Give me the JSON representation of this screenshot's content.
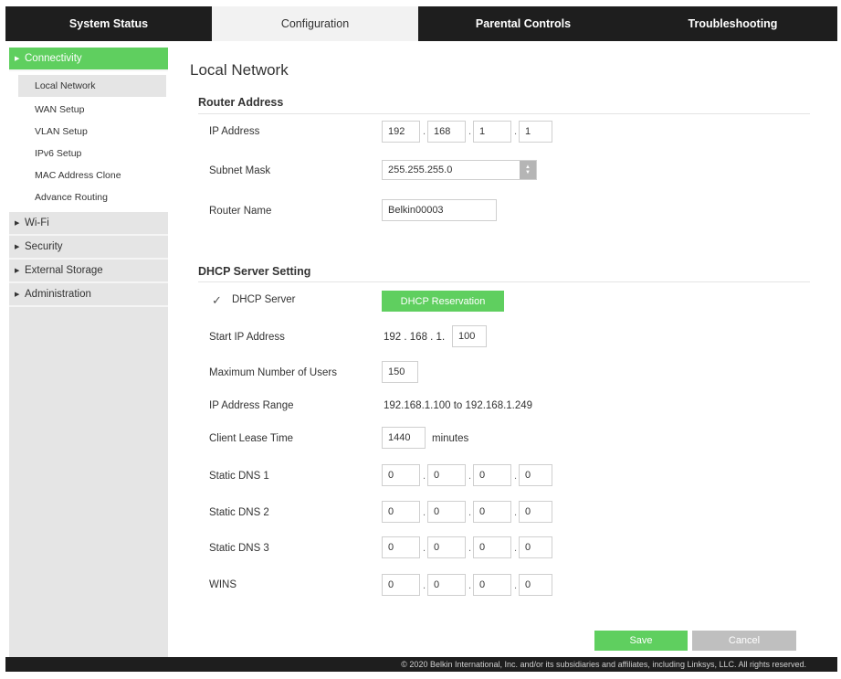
{
  "tabs": [
    {
      "label": "System Status"
    },
    {
      "label": "Configuration"
    },
    {
      "label": "Parental Controls"
    },
    {
      "label": "Troubleshooting"
    }
  ],
  "sidebar": {
    "connectivity": "Connectivity",
    "sub_items": [
      "Local Network",
      "WAN Setup",
      "VLAN Setup",
      "IPv6 Setup",
      "MAC Address Clone",
      "Advance Routing"
    ],
    "wifi": "Wi-Fi",
    "security": "Security",
    "external_storage": "External Storage",
    "administration": "Administration"
  },
  "page_title": "Local Network",
  "router_address": {
    "heading": "Router Address",
    "ip_label": "IP Address",
    "ip": [
      "192",
      "168",
      "1",
      "1"
    ],
    "subnet_label": "Subnet Mask",
    "subnet_value": "255.255.255.0",
    "router_name_label": "Router Name",
    "router_name_value": "Belkin00003"
  },
  "dhcp": {
    "heading": "DHCP Server Setting",
    "server_label": "DHCP Server",
    "check_mark": "✓",
    "reservation_button": "DHCP Reservation",
    "start_ip_label": "Start IP Address",
    "start_ip_prefix": "192 . 168 . 1.",
    "start_ip_last": "100",
    "max_users_label": "Maximum Number of Users",
    "max_users_value": "150",
    "range_label": "IP Address Range",
    "range_value": "192.168.1.100 to 192.168.1.249",
    "lease_label": "Client Lease Time",
    "lease_value": "1440",
    "lease_unit": "minutes",
    "dns1_label": "Static DNS 1",
    "dns1": [
      "0",
      "0",
      "0",
      "0"
    ],
    "dns2_label": "Static DNS 2",
    "dns2": [
      "0",
      "0",
      "0",
      "0"
    ],
    "dns3_label": "Static DNS 3",
    "dns3": [
      "0",
      "0",
      "0",
      "0"
    ],
    "wins_label": "WINS",
    "wins": [
      "0",
      "0",
      "0",
      "0"
    ]
  },
  "buttons": {
    "save": "Save",
    "cancel": "Cancel"
  },
  "footer": "© 2020 Belkin International, Inc. and/or its subsidiaries and affiliates, including Linksys, LLC. All rights reserved.",
  "colors": {
    "accent_green": "#5fcf5f",
    "header_dark": "#1e1e1e",
    "sidebar_gray": "#e5e5e5"
  }
}
